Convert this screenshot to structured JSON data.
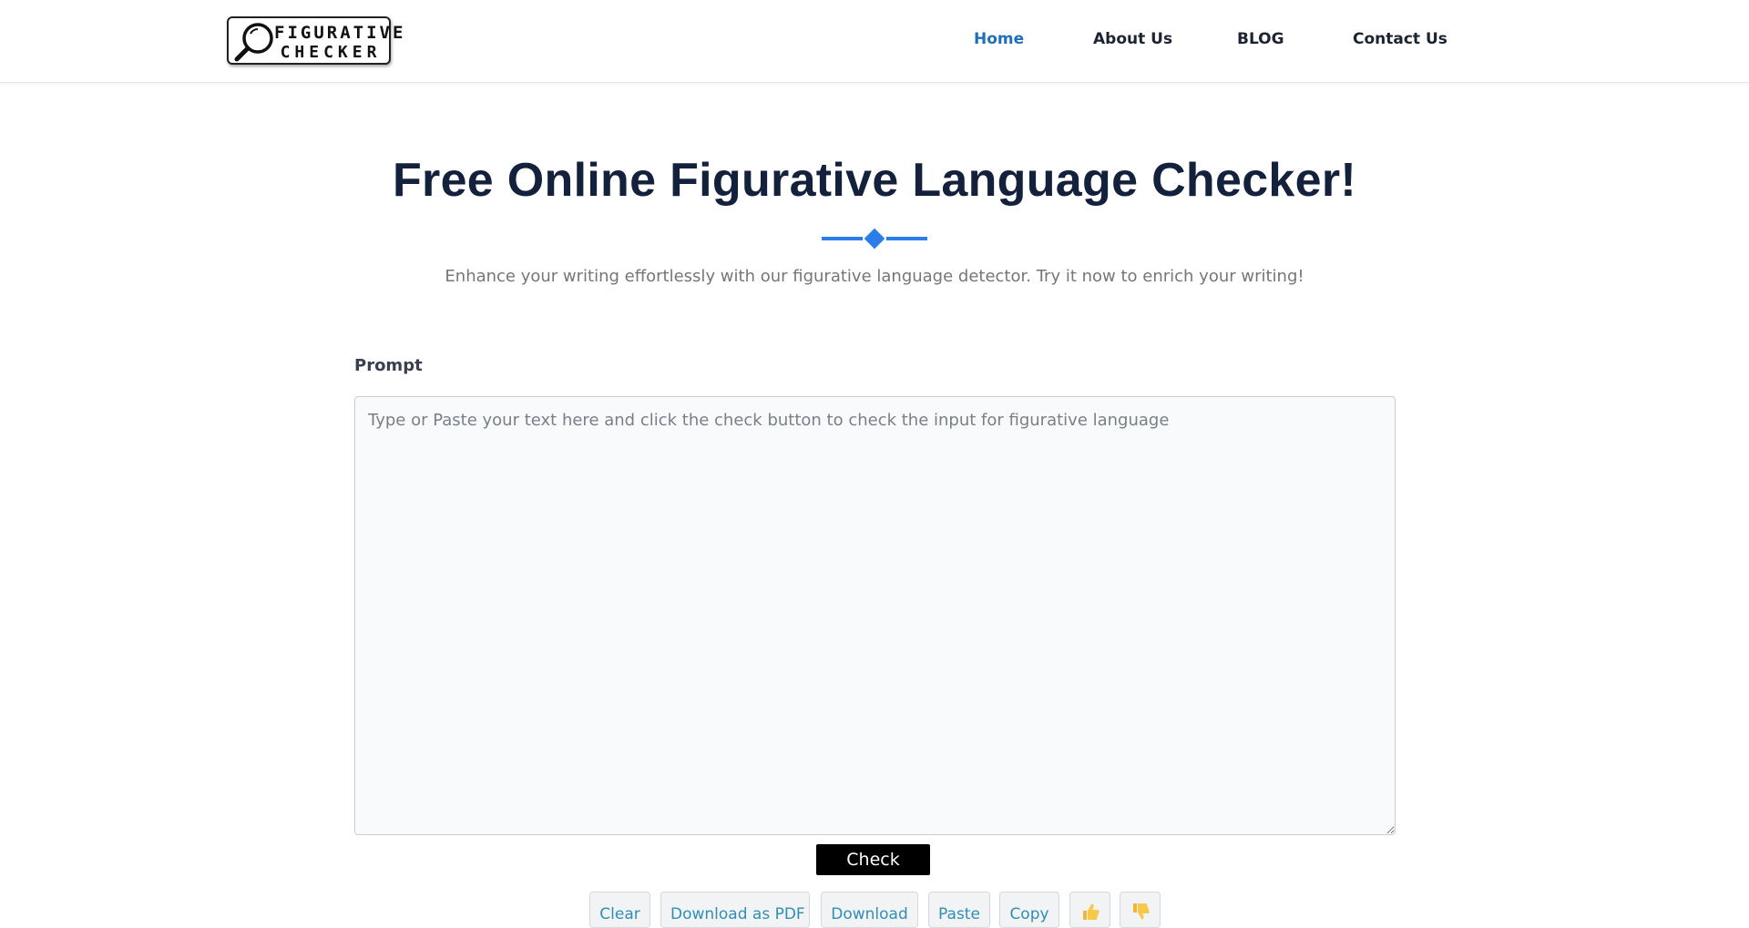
{
  "header": {
    "logo": {
      "line1": "FIGURATIVE",
      "line2": "CHECKER",
      "icon": "magnifier-icon"
    },
    "nav": [
      {
        "label": "Home",
        "active": true
      },
      {
        "label": "About Us",
        "active": false
      },
      {
        "label": "BLOG",
        "active": false
      },
      {
        "label": "Contact Us",
        "active": false
      }
    ]
  },
  "hero": {
    "title": "Free Online Figurative Language Checker!",
    "subtitle": "Enhance your writing effortlessly with our figurative language detector. Try it now to enrich your writing!"
  },
  "form": {
    "prompt_label": "Prompt",
    "placeholder": "Type or Paste your text here and click the check button to check the input for figurative language",
    "value": "",
    "check_label": "Check"
  },
  "tools": {
    "clear": "Clear",
    "download_pdf": "Download as PDF",
    "download": "Download",
    "paste": "Paste",
    "copy": "Copy",
    "thumbs_up_icon": "thumbs-up-icon",
    "thumbs_down_icon": "thumbs-down-icon"
  },
  "colors": {
    "nav_active": "#1f6fb8",
    "title": "#14213d",
    "divider": "#2b7de9",
    "tool_text": "#2f8fb3",
    "check_bg": "#000000"
  }
}
